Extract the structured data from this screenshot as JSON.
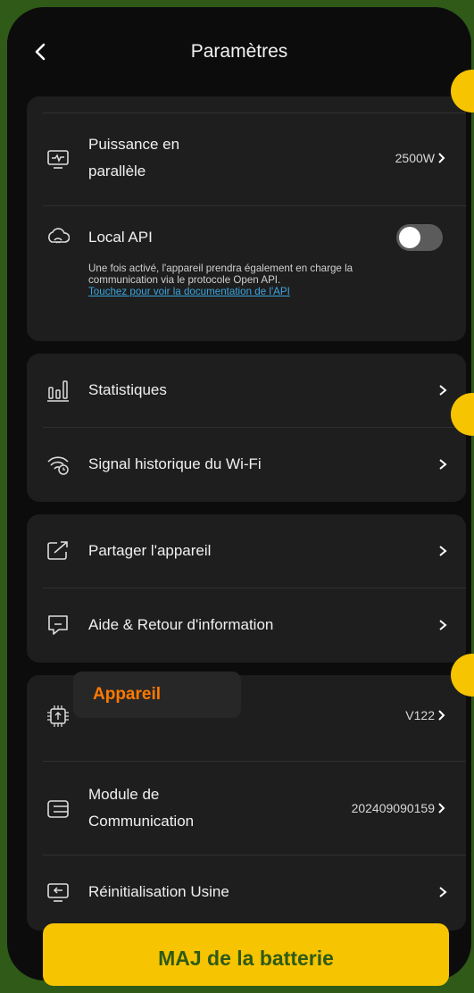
{
  "header": {
    "title": "Paramètres"
  },
  "power": {
    "label_line1": "Puissance en",
    "label_line2": "parallèle",
    "value": "2500W"
  },
  "local_api": {
    "label": "Local API",
    "enabled": false,
    "desc_line1": "Une fois activé, l'appareil prendra également en charge la",
    "desc_line2": "communication via le protocole Open API.",
    "link": "Touchez pour voir la documentation de l'API"
  },
  "stats": {
    "label": "Statistiques"
  },
  "wifi": {
    "label": "Signal historique du Wi-Fi"
  },
  "share": {
    "label": "Partager l'appareil"
  },
  "help": {
    "label": "Aide & Retour d'information"
  },
  "device": {
    "label": "Appareil",
    "value": "V122"
  },
  "module": {
    "label_line1": "Module de",
    "label_line2": "Communication",
    "value": "202409090159"
  },
  "reset": {
    "label": "Réinitialisation Usine"
  },
  "banner": {
    "text": "MAJ de la batterie"
  },
  "colors": {
    "accent": "#f6c400",
    "background": "#2f5a17",
    "highlight": "#ff7a00",
    "link": "#3aa6e0"
  }
}
